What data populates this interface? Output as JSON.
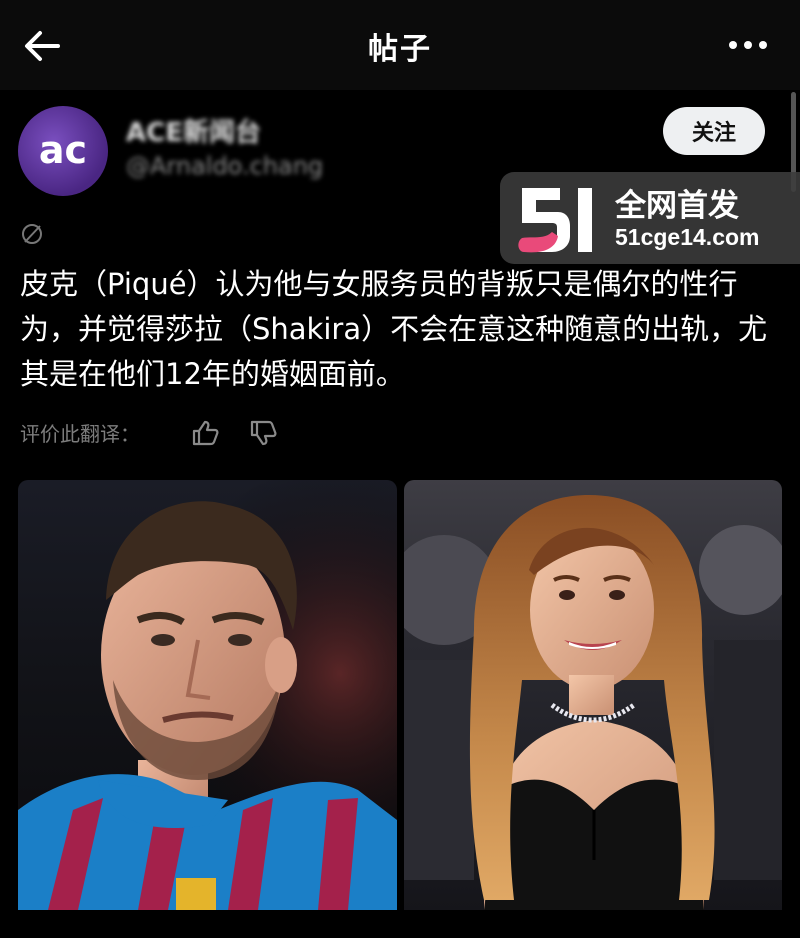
{
  "header": {
    "title": "帖子",
    "back_icon": "arrow-left-icon",
    "more_icon": "more-dots-icon"
  },
  "author": {
    "avatar_text": "ac",
    "name": "ACE新闻台",
    "handle": "@Arnaldo.chang",
    "follow_label": "关注"
  },
  "watermark": {
    "logo": "51",
    "text": "全网首发",
    "url": "51cge14.com"
  },
  "post": {
    "translate_icon": "slash-circle-icon",
    "text": "皮克（Piqué）认为他与女服务员的背叛只是偶尔的性行为，并觉得莎拉（Shakira）不会在意这种随意的出轨，尤其是在他们12年的婚姻面前。",
    "evaluate_label": "评价此翻译："
  },
  "colors": {
    "background": "#000000",
    "header": "#0b0b0b",
    "follow_button": "#eef0f2",
    "avatar": "#6a3fa8",
    "watermark_pink": "#e94a7a"
  }
}
